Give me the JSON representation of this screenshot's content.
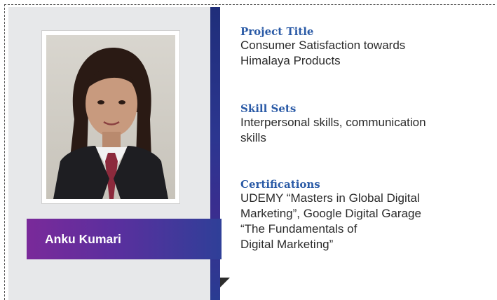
{
  "profile": {
    "name": "Anku Kumari"
  },
  "sections": [
    {
      "heading": "Project Title",
      "lines": [
        "Consumer Satisfaction towards",
        "Himalaya Products"
      ]
    },
    {
      "heading": "Skill Sets",
      "lines": [
        "Interpersonal skills, communication",
        "skills"
      ]
    },
    {
      "heading": "Certifications",
      "lines": [
        "UDEMY “Masters in Global Digital",
        "Marketing”, Google Digital Garage",
        "“The Fundamentals of",
        "Digital Marketing”"
      ]
    }
  ],
  "colors": {
    "heading": "#2a5aa6",
    "banner_start": "#7a2a9a",
    "banner_end": "#2f3f98",
    "panel": "#e7e8ea"
  }
}
